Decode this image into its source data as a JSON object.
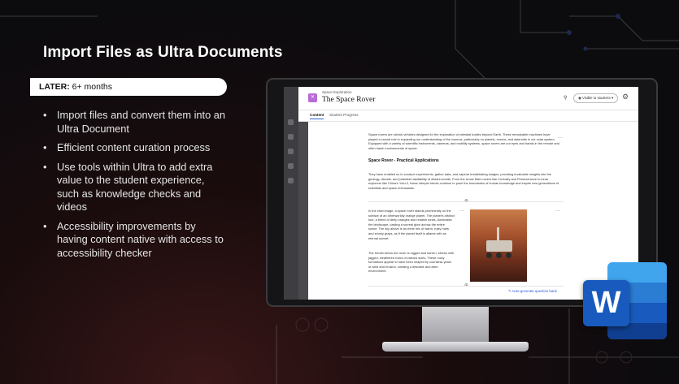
{
  "slide": {
    "title": "Import Files as Ultra Documents",
    "banner_bold": "LATER:",
    "banner_text": " 6+ months",
    "bullets": [
      "Import files and convert them into an Ultra Document",
      "Efficient content curation process",
      "Use tools within Ultra to add extra value to the student experience, such as knowledge checks and videos",
      "Accessibility improvements by having content native with access to accessibility checker"
    ]
  },
  "screen": {
    "breadcrumb": "Space Exploration",
    "doc_title": "The Space Rover",
    "visibility": "Visible to students",
    "tabs": [
      "Content",
      "Student Progress"
    ],
    "paragraph1": "Space rovers are robotic vehicles designed for the exploration of celestial bodies beyond Earth. These remarkable machines have played a crucial role in expanding our understanding of the cosmos, particularly on planets, moons, and asteroids in our solar system. Equipped with a variety of scientific instruments, cameras, and mobility systems, space rovers are our eyes and hands in the remote and often harsh environments of space.",
    "heading": "Space Rover - Practical Applications",
    "paragraph2": "They have enabled us to conduct experiments, gather data, and capture breathtaking images, providing invaluable insights into the geology, climate, and potential habitability of distant worlds. From the iconic Mars rovers like Curiosity and Perseverance to lunar explorers like China's Yutu-2, these intrepid robots continue to push the boundaries of human knowledge and inspire new generations of scientists and space enthusiasts.",
    "paragraph3": "In the vivid image, a space rover stands prominently on the surface of an otherworldly orange planet. The planet's distinct hue, a blend of deep oranges and reddish tones, dominates the landscape, casting a surreal glow across the entire scene. The sky above is an eerie mix of warm, rusty hues and smoky grays, as if the planet itself is aflame with an eternal sunset.",
    "paragraph4": "The terrain below the rover is rugged and barren, strewn with jagged, weathered rocks of various sizes. These rocky formations appear to have been shaped by countless years of wind and erosion, creating a desolate and alien environment.",
    "auto_generate": "Auto-generate question bank"
  },
  "icons": [
    "pin-icon",
    "eye-icon",
    "settings-icon",
    "more-icon",
    "add-icon",
    "magic-wand-icon",
    "word-logo"
  ],
  "colors": {
    "accent": "#2b5fd9",
    "word_blue": "#185abd",
    "app_icon": "#b86bd6"
  }
}
